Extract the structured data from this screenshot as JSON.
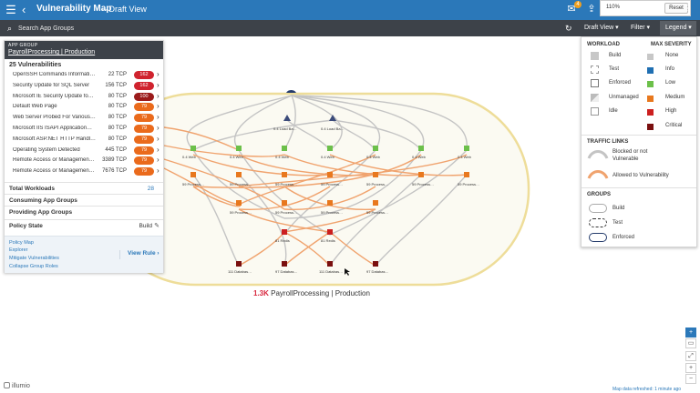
{
  "header": {
    "title": "Vulnerability Map",
    "subtitle": "–  Draft View",
    "notification_count": "4",
    "zoom": "110%",
    "reset_label": "Reset"
  },
  "search": {
    "placeholder": "Search App Groups"
  },
  "toolbar": {
    "draft_view": "Draft View ▾",
    "filter": "Filter ▾",
    "legend": "Legend ▾"
  },
  "app_group_panel": {
    "kind": "APP GROUP",
    "name": "PayrollProcessing | Production",
    "vuln_count_label": "25 Vulnerabilities",
    "vulnerabilities": [
      {
        "name": "OpenSSH Commands Informati…",
        "port": "22 TCP",
        "score": "162",
        "color": "#d0232e"
      },
      {
        "name": "Security Update for SQL Server",
        "port": "156 TCP",
        "score": "162",
        "color": "#d0232e"
      },
      {
        "name": "Microsoft IE Security Update fo…",
        "port": "80 TCP",
        "score": "100",
        "color": "#9b1b1b"
      },
      {
        "name": "Default Web Page",
        "port": "80 TCP",
        "score": "79",
        "color": "#ea6a1c"
      },
      {
        "name": "Web Server Probed For Various…",
        "port": "80 TCP",
        "score": "79",
        "color": "#ea6a1c"
      },
      {
        "name": "Microsoft IIS ISAPI Application…",
        "port": "80 TCP",
        "score": "79",
        "color": "#ea6a1c"
      },
      {
        "name": "Microsoft ASP.NET HTTP Handl…",
        "port": "80 TCP",
        "score": "79",
        "color": "#ea6a1c"
      },
      {
        "name": "Operating System Detected",
        "port": "445 TCP",
        "score": "79",
        "color": "#ea6a1c"
      },
      {
        "name": "Remote Access or Managemen…",
        "port": "3389 TCP",
        "score": "79",
        "color": "#ea6a1c"
      },
      {
        "name": "Remote Access or Managemen…",
        "port": "7676 TCP",
        "score": "79",
        "color": "#ea6a1c"
      }
    ],
    "total_workloads_label": "Total Workloads",
    "total_workloads_value": "28",
    "consuming_label": "Consuming App Groups",
    "providing_label": "Providing App Groups",
    "policy_state_label": "Policy State",
    "policy_state_value": "Build",
    "links": [
      "Policy Map",
      "Explorer",
      "Mitigate Vulnerabilities",
      "Collapse Group Roles"
    ],
    "view_rule": "View Rule ›"
  },
  "legend": {
    "workload_heading": "WORKLOAD",
    "max_severity_heading": "MAX SEVERITY",
    "workload_states": [
      "Build",
      "Test",
      "Enforced",
      "Unmanaged",
      "Idle"
    ],
    "severities": [
      {
        "label": "None",
        "color": "#c7c7c7"
      },
      {
        "label": "Info",
        "color": "#1f6fb2"
      },
      {
        "label": "Low",
        "color": "#6cc04a"
      },
      {
        "label": "Medium",
        "color": "#e8781e"
      },
      {
        "label": "High",
        "color": "#cc1f1f"
      },
      {
        "label": "Critical",
        "color": "#7a0f0f"
      }
    ],
    "traffic_heading": "TRAFFIC LINKS",
    "traffic_blocked": "Blocked or not",
    "traffic_blocked_2": "Vulnerable",
    "traffic_allowed": "Allowed to Vulnerability",
    "groups_heading": "GROUPS",
    "groups": [
      "Build",
      "Test",
      "Enforced"
    ]
  },
  "map": {
    "group_count": "1.3K",
    "group_name": "PayrollProcessing | Production",
    "node_labels": {
      "load": "0.4 Load Ba…",
      "web": "0.4 Web",
      "process": "59 Process…",
      "redis": "81 Redis",
      "database": "111 Databas…",
      "database_b": "97 Databas…"
    }
  },
  "footer": {
    "logo": "illumio",
    "refreshed": "Map data refreshed: 1 minute ago"
  }
}
